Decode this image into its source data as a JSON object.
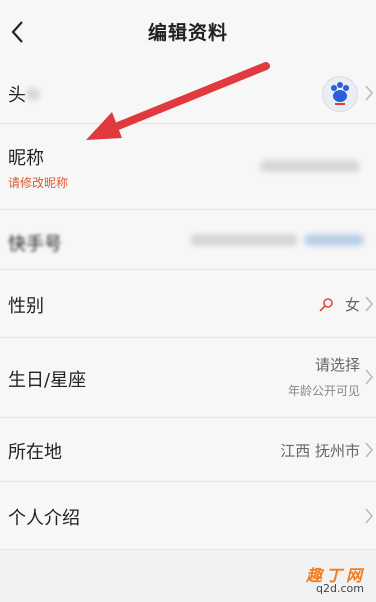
{
  "header": {
    "title": "编辑资料"
  },
  "rows": {
    "avatar": {
      "label": "头"
    },
    "nickname": {
      "label": "昵称",
      "hint": "请修改昵称"
    },
    "kuaishou_id": {
      "label": "快手号"
    },
    "gender": {
      "label": "性别",
      "value": "女"
    },
    "birthday": {
      "label": "生日/星座",
      "value": "请选择",
      "sub": "年龄公开可见"
    },
    "location": {
      "label": "所在地",
      "value": "江西 抚州市"
    },
    "bio": {
      "label": "个人介绍"
    }
  },
  "colors": {
    "hint": "#e1572f",
    "arrow": "#e0393e"
  },
  "watermark": {
    "title": "趣丁网",
    "url": "q2d.com"
  }
}
